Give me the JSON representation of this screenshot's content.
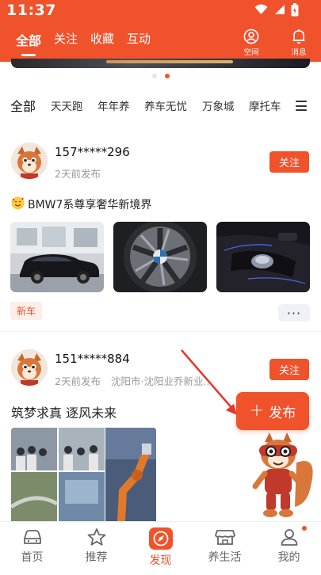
{
  "status_bar": {
    "time": "11:37"
  },
  "header": {
    "tabs": [
      {
        "label": "全部",
        "active": true
      },
      {
        "label": "关注",
        "active": false
      },
      {
        "label": "收藏",
        "active": false
      },
      {
        "label": "互动",
        "active": false
      }
    ],
    "space_label": "空间",
    "message_label": "消息",
    "icons": {
      "space": "person-circle-icon",
      "message": "bell-icon"
    }
  },
  "carousel": {
    "page_count": 2,
    "active_index": 1
  },
  "categories": {
    "items": [
      "全部",
      "天天跑",
      "年年养",
      "养车无忧",
      "万象城",
      "摩托车"
    ],
    "active": "全部",
    "menu_icon": "hamburger-menu-icon"
  },
  "posts": [
    {
      "username": "157*****296",
      "meta": "2天前发布",
      "follow_label": "关注",
      "emoji": "smiling-face-with-hearts-icon",
      "title": "BMW7系尊享奢华新境界",
      "images": [
        "car-showroom-photo",
        "car-wheel-photo",
        "car-interior-console-photo"
      ],
      "tag": "新车",
      "more_label": "···"
    },
    {
      "username": "151*****884",
      "meta": "2天前发布",
      "location": "沈阳市·沈阳业乔新业...",
      "follow_label": "关注",
      "title": "筑梦求真 逐风未来",
      "images": [
        "collage-grid-photo",
        "robot-arm-photo"
      ]
    }
  ],
  "publish_button": {
    "plus": "+",
    "label": "发布"
  },
  "mascot": "squirrel-mascot-icon",
  "colors": {
    "brand": "#f0522c",
    "tag_bg": "#fdeee7"
  },
  "bottom_nav": [
    {
      "label": "首页",
      "icon": "car-icon",
      "active": false
    },
    {
      "label": "推荐",
      "icon": "star-icon",
      "active": false
    },
    {
      "label": "发现",
      "icon": "compass-icon",
      "active": true
    },
    {
      "label": "养生活",
      "icon": "store-icon",
      "active": false
    },
    {
      "label": "我的",
      "icon": "person-icon",
      "active": false,
      "badge_dot": true
    }
  ]
}
